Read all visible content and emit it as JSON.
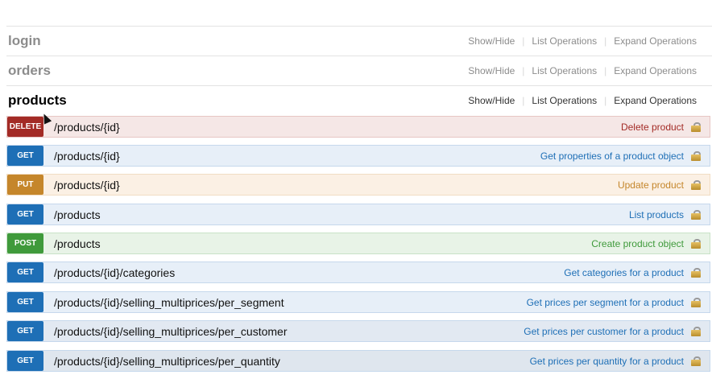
{
  "resources": [
    {
      "name": "login",
      "show_hide": "Show/Hide",
      "list_ops": "List Operations",
      "expand_ops": "Expand Operations"
    },
    {
      "name": "orders",
      "show_hide": "Show/Hide",
      "list_ops": "List Operations",
      "expand_ops": "Expand Operations"
    },
    {
      "name": "products",
      "show_hide": "Show/Hide",
      "list_ops": "List Operations",
      "expand_ops": "Expand Operations"
    }
  ],
  "operations": [
    {
      "method": "DELETE",
      "path": "/products/{id}",
      "summary": "Delete product"
    },
    {
      "method": "GET",
      "path": "/products/{id}",
      "summary": "Get properties of a product object"
    },
    {
      "method": "PUT",
      "path": "/products/{id}",
      "summary": "Update product"
    },
    {
      "method": "GET",
      "path": "/products",
      "summary": "List products"
    },
    {
      "method": "POST",
      "path": "/products",
      "summary": "Create product object"
    },
    {
      "method": "GET",
      "path": "/products/{id}/categories",
      "summary": "Get categories for a product"
    },
    {
      "method": "GET",
      "path": "/products/{id}/selling_multiprices/per_segment",
      "summary": "Get prices per segment for a product"
    },
    {
      "method": "GET",
      "path": "/products/{id}/selling_multiprices/per_customer",
      "summary": "Get prices per customer for a product"
    },
    {
      "method": "GET",
      "path": "/products/{id}/selling_multiprices/per_quantity",
      "summary": "Get prices per quantity for a product"
    }
  ],
  "icons": {
    "lock": "lock-icon",
    "cursor": "mouse-cursor-icon"
  },
  "colors": {
    "delete": "#a32b26",
    "get": "#1e6fb6",
    "put": "#c5862b",
    "post": "#3f9a3b"
  }
}
